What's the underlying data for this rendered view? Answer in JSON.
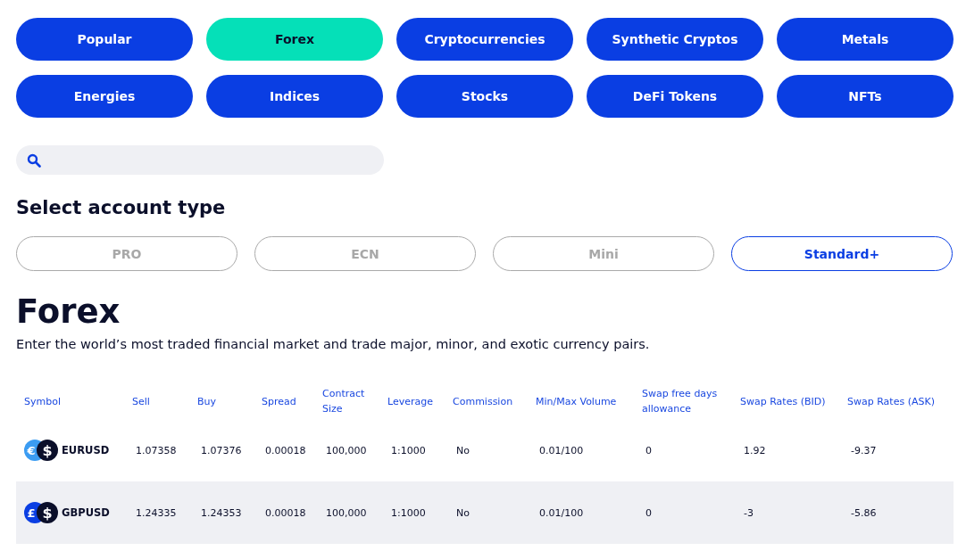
{
  "categories": [
    {
      "label": "Popular",
      "selected": false
    },
    {
      "label": "Forex",
      "selected": true
    },
    {
      "label": "Cryptocurrencies",
      "selected": false
    },
    {
      "label": "Synthetic Cryptos",
      "selected": false
    },
    {
      "label": "Metals",
      "selected": false
    },
    {
      "label": "Energies",
      "selected": false
    },
    {
      "label": "Indices",
      "selected": false
    },
    {
      "label": "Stocks",
      "selected": false
    },
    {
      "label": "DeFi Tokens",
      "selected": false
    },
    {
      "label": "NFTs",
      "selected": false
    }
  ],
  "account_section": {
    "heading": "Select account type",
    "account_types": [
      {
        "label": "PRO",
        "selected": false
      },
      {
        "label": "ECN",
        "selected": false
      },
      {
        "label": "Mini",
        "selected": false
      },
      {
        "label": "Standard+",
        "selected": true
      }
    ]
  },
  "market": {
    "title": "Forex",
    "description": "Enter the world’s most traded financial market and trade major, minor, and exotic currency pairs."
  },
  "table": {
    "columns": [
      "Symbol",
      "Sell",
      "Buy",
      "Spread",
      "Contract Size",
      "Leverage",
      "Commission",
      "Min/Max Volume",
      "Swap free days allowance",
      "Swap Rates (BID)",
      "Swap Rates (ASK)"
    ],
    "rows": [
      {
        "base_sign": "€",
        "quote_sign": "$",
        "color": "#3b9cf2",
        "cells": [
          "EURUSD",
          "1.07358",
          "1.07376",
          "0.00018",
          "100,000",
          "1:1000",
          "No",
          "0.01/100",
          "0",
          "1.92",
          "-9.37"
        ]
      },
      {
        "base_sign": "£",
        "quote_sign": "$",
        "color": "#0b3fe3",
        "cells": [
          "GBPUSD",
          "1.24335",
          "1.24353",
          "0.00018",
          "100,000",
          "1:1000",
          "No",
          "0.01/100",
          "0",
          "-3",
          "-5.86"
        ]
      }
    ]
  }
}
